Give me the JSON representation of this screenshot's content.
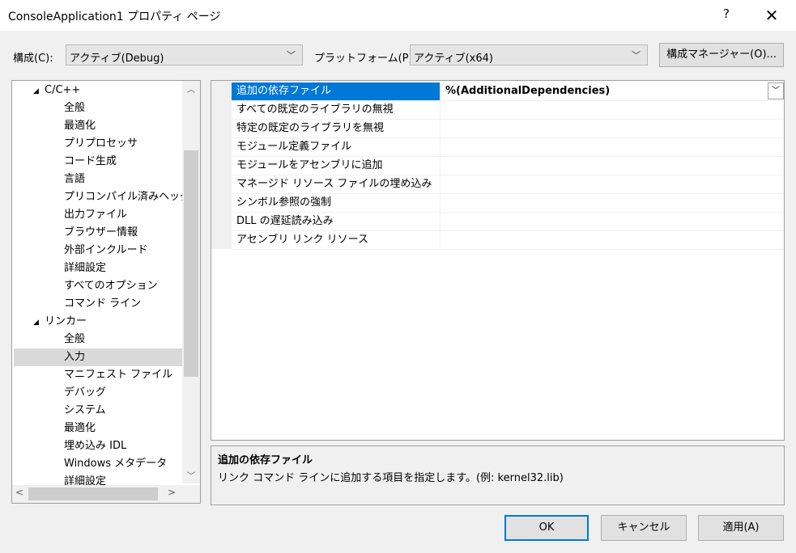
{
  "window": {
    "title": "ConsoleApplication1 プロパティ ページ",
    "help": "?",
    "close": "✕"
  },
  "toolbar": {
    "config_label": "構成(C):",
    "config_value": "アクティブ(Debug)",
    "platform_label": "プラットフォーム(P):",
    "platform_value": "アクティブ(x64)",
    "config_manager": "構成マネージャー(O)...",
    "dropdown_glyph": "﹀"
  },
  "tree": {
    "items": [
      {
        "label": "C/C++",
        "level": 1,
        "expanded": true
      },
      {
        "label": "全般",
        "level": 2
      },
      {
        "label": "最適化",
        "level": 2
      },
      {
        "label": "プリプロセッサ",
        "level": 2
      },
      {
        "label": "コード生成",
        "level": 2
      },
      {
        "label": "言語",
        "level": 2
      },
      {
        "label": "プリコンパイル済みヘッダー",
        "level": 2
      },
      {
        "label": "出力ファイル",
        "level": 2
      },
      {
        "label": "ブラウザー情報",
        "level": 2
      },
      {
        "label": "外部インクルード",
        "level": 2
      },
      {
        "label": "詳細設定",
        "level": 2
      },
      {
        "label": "すべてのオプション",
        "level": 2
      },
      {
        "label": "コマンド ライン",
        "level": 2
      },
      {
        "label": "リンカー",
        "level": 1,
        "expanded": true
      },
      {
        "label": "全般",
        "level": 2
      },
      {
        "label": "入力",
        "level": 2,
        "selected": true
      },
      {
        "label": "マニフェスト ファイル",
        "level": 2
      },
      {
        "label": "デバッグ",
        "level": 2
      },
      {
        "label": "システム",
        "level": 2
      },
      {
        "label": "最適化",
        "level": 2
      },
      {
        "label": "埋め込み IDL",
        "level": 2
      },
      {
        "label": "Windows メタデータ",
        "level": 2
      },
      {
        "label": "詳細設定",
        "level": 2
      }
    ],
    "expand_glyph": "◢"
  },
  "properties": [
    {
      "name": "追加の依存ファイル",
      "value": "%(AdditionalDependencies)",
      "selected": true
    },
    {
      "name": "すべての既定のライブラリの無視",
      "value": ""
    },
    {
      "name": "特定の既定のライブラリを無視",
      "value": ""
    },
    {
      "name": "モジュール定義ファイル",
      "value": ""
    },
    {
      "name": "モジュールをアセンブリに追加",
      "value": ""
    },
    {
      "name": "マネージド リソース ファイルの埋め込み",
      "value": ""
    },
    {
      "name": "シンボル参照の強制",
      "value": ""
    },
    {
      "name": "DLL の遅延読み込み",
      "value": ""
    },
    {
      "name": "アセンブリ リンク リソース",
      "value": ""
    }
  ],
  "description": {
    "title": "追加の依存ファイル",
    "text": "リンク コマンド ラインに追加する項目を指定します。(例: kernel32.lib)"
  },
  "buttons": {
    "ok": "OK",
    "cancel": "キャンセル",
    "apply": "適用(A)"
  },
  "colors": {
    "accent": "#0078d7",
    "selection_tree": "#d9d9d9"
  }
}
